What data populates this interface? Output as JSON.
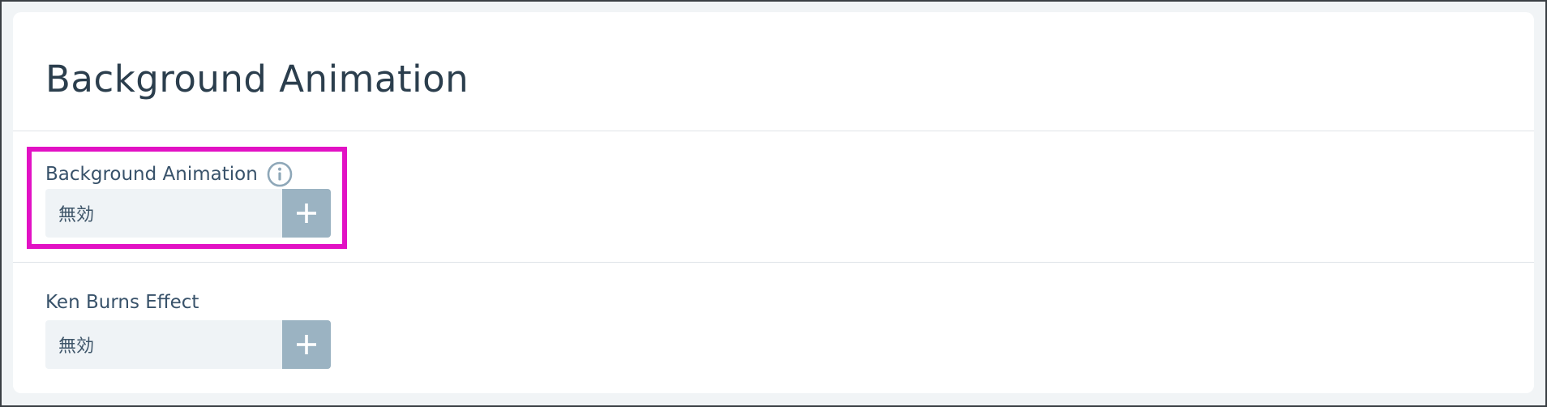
{
  "panel": {
    "title": "Background Animation"
  },
  "fields": [
    {
      "label": "Background Animation",
      "value": "無効",
      "has_info_icon": true,
      "highlighted": true
    },
    {
      "label": "Ken Burns Effect",
      "value": "無効",
      "has_info_icon": false,
      "highlighted": false
    }
  ],
  "icons": {
    "info": "info-circle-icon",
    "add": "plus-icon"
  },
  "colors": {
    "highlight": "#e212c4",
    "add_button": "#9bb3c2",
    "select_bg": "#eff3f6",
    "title_text": "#2b3e4d",
    "label_text": "#38526a"
  }
}
